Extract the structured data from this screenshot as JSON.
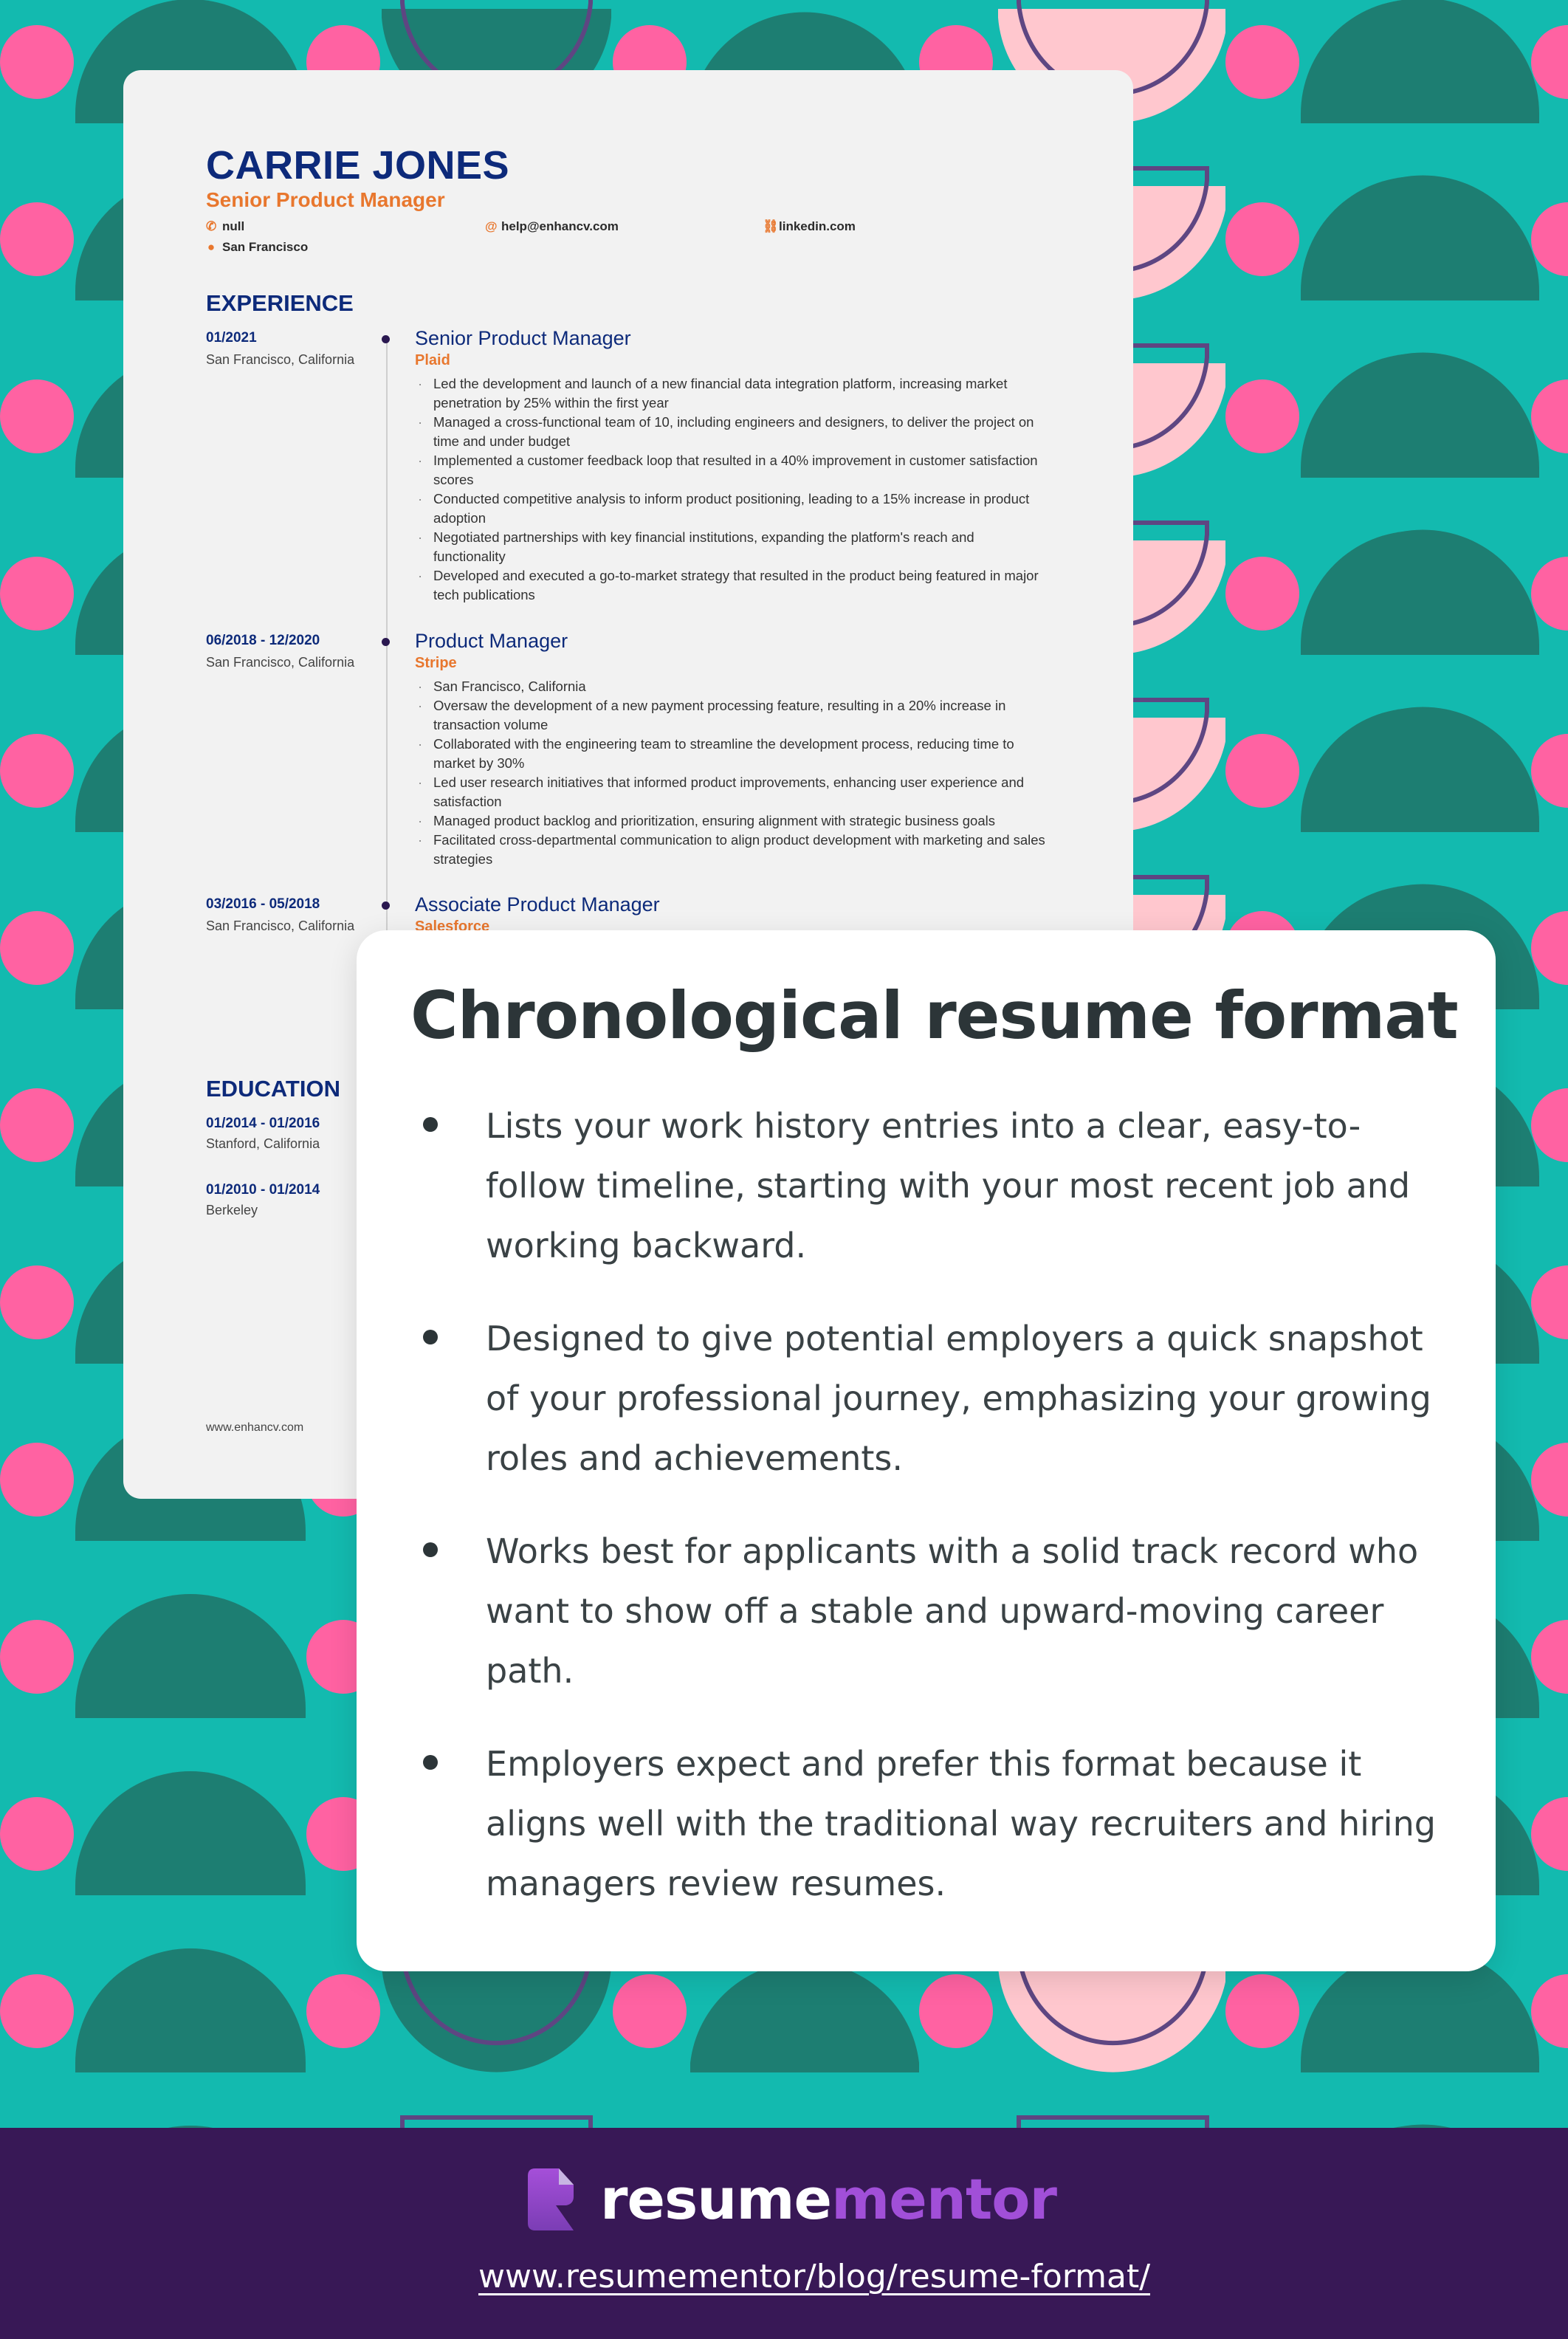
{
  "colors": {
    "background": "#13BAAF",
    "dark_teal": "#1D7E72",
    "pink": "#FF62A2",
    "light_pink": "#FFC7CE",
    "purple_outline": "#5E4682",
    "resume_navy": "#0D2A7A",
    "resume_orange": "#E8772E",
    "footer_bg": "#381856",
    "brand_purple": "#A14FD8"
  },
  "resume": {
    "name": "CARRIE JONES",
    "title": "Senior Product Manager",
    "contacts": [
      {
        "icon": "phone-icon",
        "glyph": "✆",
        "text": "null"
      },
      {
        "icon": "at-icon",
        "glyph": "@",
        "text": "help@enhancv.com"
      },
      {
        "icon": "link-icon",
        "glyph": "🔗",
        "text": "linkedin.com"
      },
      {
        "icon": "location-pin-icon",
        "glyph": "⚲",
        "text": "San Francisco"
      }
    ],
    "experience_heading": "EXPERIENCE",
    "jobs": [
      {
        "date": "01/2021",
        "location": "San Francisco, California",
        "role": "Senior Product Manager",
        "company": "Plaid",
        "bullets": [
          "Led the development and launch of a new financial data integration platform, increasing market penetration by 25% within the first year",
          "Managed a cross-functional team of 10, including engineers and designers, to deliver the project on time and under budget",
          "Implemented a customer feedback loop that resulted in a 40% improvement in customer satisfaction scores",
          "Conducted competitive analysis to inform product positioning, leading to a 15% increase in product adoption",
          "Negotiated partnerships with key financial institutions, expanding the platform's reach and functionality",
          "Developed and executed a go-to-market strategy that resulted in the product being featured in major tech publications"
        ]
      },
      {
        "date": "06/2018 - 12/2020",
        "location": "San Francisco, California",
        "role": "Product Manager",
        "company": "Stripe",
        "bullets": [
          "San Francisco, California",
          "Oversaw the development of a new payment processing feature, resulting in a 20% increase in transaction volume",
          "Collaborated with the engineering team to streamline the development process, reducing time to market by 30%",
          "Led user research initiatives that informed product improvements, enhancing user experience and satisfaction",
          "Managed product backlog and prioritization, ensuring alignment with strategic business goals",
          "Facilitated cross-departmental communication to align product development with marketing and sales strategies"
        ]
      },
      {
        "date": "03/2016 - 05/2018",
        "location": "San Francisco, California",
        "role": "Associate Product Manager",
        "company": "Salesforce",
        "bullets": []
      }
    ],
    "education_heading": "EDUCATION",
    "education": [
      {
        "date": "01/2014 - 01/2016",
        "location": "Stanford, California"
      },
      {
        "date": "01/2010 - 01/2014",
        "location": "Berkeley"
      }
    ],
    "footer": "www.enhancv.com"
  },
  "info_card": {
    "title": "Chronological resume format",
    "bullets": [
      "Lists your work history entries into a clear, easy-to-follow timeline, starting with your most recent job and working backward.",
      "Designed to give potential employers a quick snapshot of your professional journey, emphasizing your growing roles and achievements.",
      "Works best for applicants with a solid track record who want to show off a stable and upward-moving career path.",
      "Employers expect and prefer this format because it aligns well with the traditional way recruiters and hiring managers review resumes."
    ]
  },
  "footer": {
    "logo_part1": "resume",
    "logo_part2": "mentor",
    "url": "www.resumementor/blog/resume-format/"
  }
}
